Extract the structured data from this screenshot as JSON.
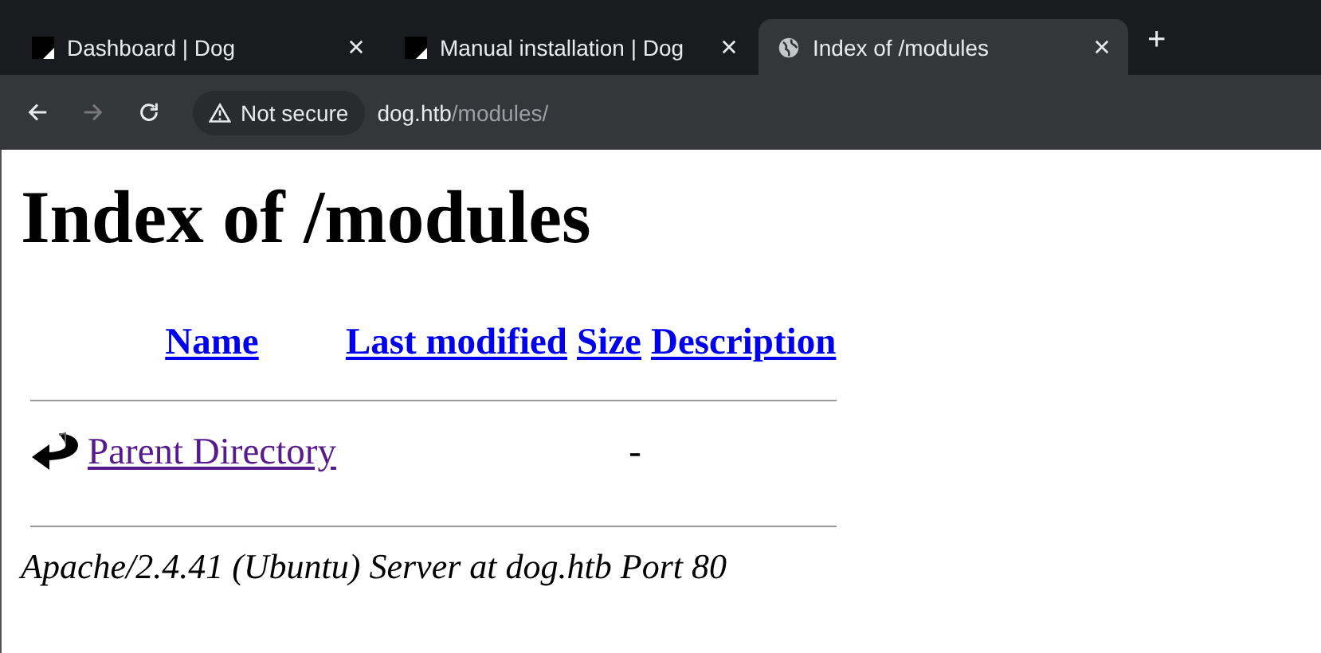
{
  "tabs": [
    {
      "title": "Dashboard | Dog",
      "kind": "favicon",
      "selected": false
    },
    {
      "title": "Manual installation | Dog",
      "kind": "favicon",
      "selected": false
    },
    {
      "title": "Index of /modules",
      "kind": "globe",
      "selected": true
    }
  ],
  "new_tab": "+",
  "toolbar": {
    "back_disabled": false,
    "forward_disabled": true,
    "security": "Not secure",
    "url_host": "dog.htb",
    "url_path": "/modules/"
  },
  "page": {
    "heading": "Index of /modules",
    "columns": [
      "Name",
      "Last modified",
      "Size",
      "Description"
    ],
    "rows": [
      {
        "name": "Parent Directory",
        "last_modified": "",
        "size": "-",
        "description": "",
        "visited": true
      }
    ],
    "footer": "Apache/2.4.41 (Ubuntu) Server at dog.htb Port 80"
  }
}
